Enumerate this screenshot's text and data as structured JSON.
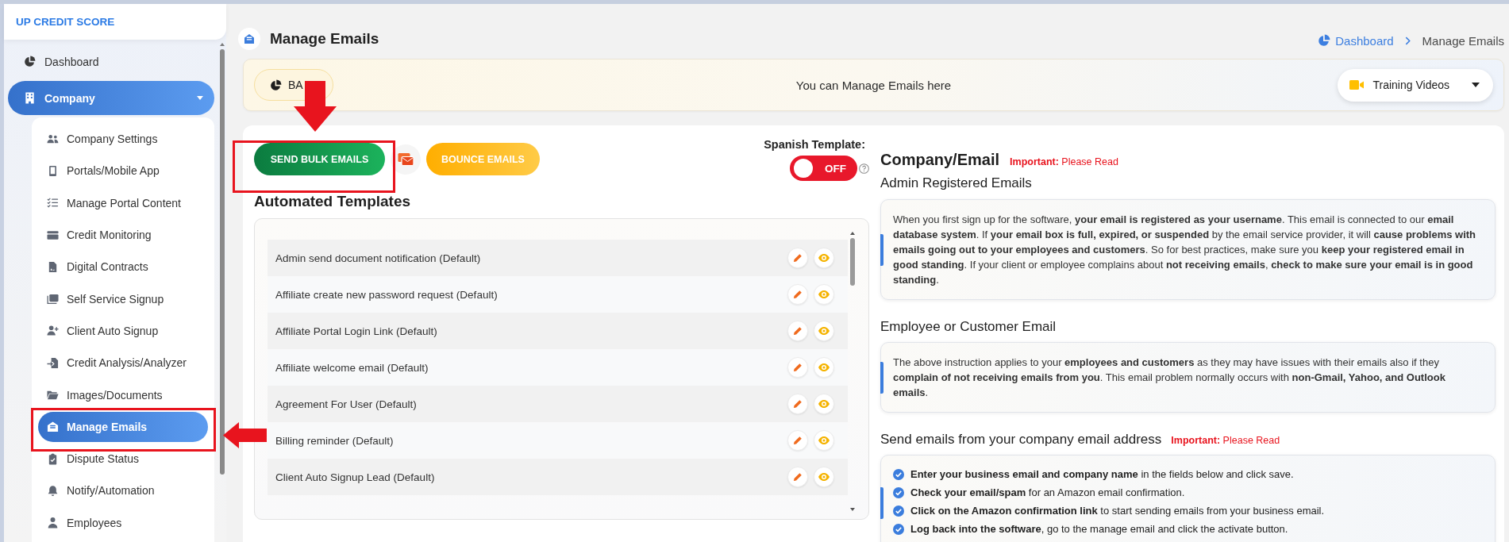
{
  "sidebar": {
    "logo": "UP CREDIT SCORE",
    "items": [
      {
        "label": "Dashboard",
        "selected": false
      },
      {
        "label": "Company",
        "selected": true,
        "expanded": true,
        "children": [
          {
            "label": "Company Settings",
            "selected": false
          },
          {
            "label": "Portals/Mobile App",
            "selected": false
          },
          {
            "label": "Manage Portal Content",
            "selected": false
          },
          {
            "label": "Credit Monitoring",
            "selected": false
          },
          {
            "label": "Digital Contracts",
            "selected": false
          },
          {
            "label": "Self Service Signup",
            "selected": false
          },
          {
            "label": "Client Auto Signup",
            "selected": false
          },
          {
            "label": "Credit Analysis/Analyzer",
            "selected": false
          },
          {
            "label": "Images/Documents",
            "selected": false
          },
          {
            "label": "Manage Emails",
            "selected": true
          },
          {
            "label": "Dispute Status",
            "selected": false
          },
          {
            "label": "Notify/Automation",
            "selected": false
          },
          {
            "label": "Employees",
            "selected": false
          }
        ]
      }
    ]
  },
  "header": {
    "title": "Manage Emails",
    "breadcrumb": [
      {
        "label": "Dashboard",
        "kind": "link"
      },
      {
        "label": "Manage Emails",
        "kind": "current"
      }
    ]
  },
  "banner": {
    "back_button": "BA",
    "message": "You can Manage Emails here",
    "training_button": "Training Videos"
  },
  "actions": {
    "send_bulk_button": "SEND BULK EMAILS",
    "bounce_button": "BOUNCE EMAILS",
    "spanish_template": {
      "label": "Spanish Template:",
      "on": false,
      "state_text": "OFF"
    }
  },
  "templates": {
    "title": "Automated Templates",
    "rows": [
      "Admin send document notification (Default)",
      "Affiliate create new password request (Default)",
      "Affiliate Portal Login Link (Default)",
      "Affiliate welcome email (Default)",
      "Agreement For User (Default)",
      "Billing reminder (Default)",
      "Client Auto Signup Lead (Default)"
    ]
  },
  "info_panel": {
    "title": "Company/Email",
    "note": "**Important:** Please Read",
    "sections": [
      {
        "heading": "Admin Registered Emails",
        "kind": "paragraph",
        "text": "When you first sign up for the software, **your email is registered as your username**. This email is connected to our **email database system**. If **your email box is full, expired, or suspended** by the email service provider, it will **cause problems with emails going out to your employees and customers**. So for best practices, make sure you **keep your registered email in good standing**. If your client or employee complains about **not receiving emails**, **check to make sure your email is in good standing**."
      },
      {
        "heading": "Employee or Customer Email",
        "kind": "paragraph",
        "text": "The above instruction applies to your **employees and customers** as they may have issues with their emails also if they **complain of not receiving emails from you**. This email problem normally occurs with **non-Gmail, Yahoo, and Outlook emails**."
      },
      {
        "heading": "Send emails from your company email address",
        "note": "**Important:** Please Read",
        "kind": "checklist",
        "items": [
          "**Enter your business email and company name** in the fields below and click save.",
          "**Check your email/spam** for an Amazon email confirmation.",
          "**Click on the Amazon confirmation link** to start sending emails from your business email.",
          "**Log back into the software**, go to the manage email and click the activate button."
        ]
      }
    ]
  }
}
